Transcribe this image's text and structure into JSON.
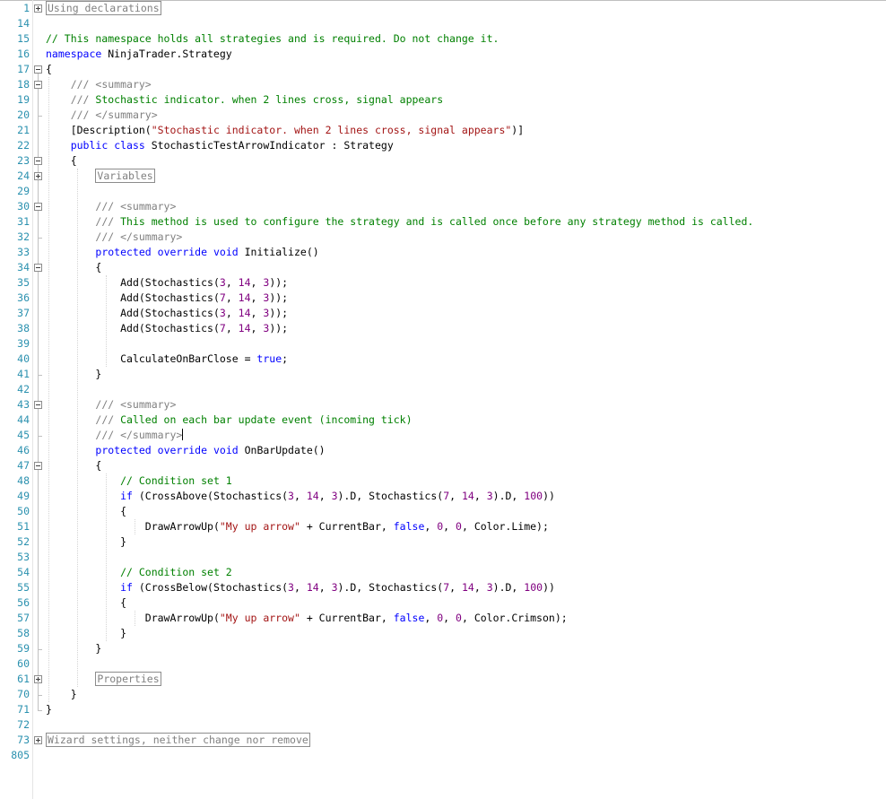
{
  "editor": {
    "lines": [
      {
        "n": "1",
        "indent": "",
        "seg": [
          {
            "t": "Using declarations",
            "c": "collapsed"
          }
        ],
        "fold": "plus"
      },
      {
        "n": "14",
        "indent": "",
        "seg": []
      },
      {
        "n": "15",
        "indent": "",
        "seg": [
          {
            "t": "// This namespace holds all strategies and is required. Do not change it.",
            "c": "cm"
          }
        ]
      },
      {
        "n": "16",
        "indent": "",
        "seg": [
          {
            "t": "namespace",
            "c": "kw"
          },
          {
            "t": " NinjaTrader.Strategy"
          }
        ]
      },
      {
        "n": "17",
        "indent": "",
        "seg": [
          {
            "t": "{"
          }
        ],
        "fold": "minus"
      },
      {
        "n": "18",
        "indent": "    ",
        "seg": [
          {
            "t": "/// <summary>",
            "c": "xd"
          }
        ],
        "fold": "minus"
      },
      {
        "n": "19",
        "indent": "    ",
        "seg": [
          {
            "t": "/// ",
            "c": "xd"
          },
          {
            "t": "Stochastic indicator. when 2 lines cross, signal appears",
            "c": "cm"
          }
        ]
      },
      {
        "n": "20",
        "indent": "    ",
        "seg": [
          {
            "t": "/// </summary>",
            "c": "xd"
          }
        ]
      },
      {
        "n": "21",
        "indent": "    ",
        "seg": [
          {
            "t": "[Description("
          },
          {
            "t": "\"Stochastic indicator. when 2 lines cross, signal appears\"",
            "c": "st"
          },
          {
            "t": ")]"
          }
        ]
      },
      {
        "n": "22",
        "indent": "    ",
        "seg": [
          {
            "t": "public",
            "c": "kw"
          },
          {
            "t": " "
          },
          {
            "t": "class",
            "c": "kw"
          },
          {
            "t": " StochasticTestArrowIndicator : Strategy"
          }
        ]
      },
      {
        "n": "23",
        "indent": "    ",
        "seg": [
          {
            "t": "{"
          }
        ],
        "fold": "minus"
      },
      {
        "n": "24",
        "indent": "        ",
        "seg": [
          {
            "t": "Variables",
            "c": "collapsed"
          }
        ],
        "fold": "plus"
      },
      {
        "n": "29",
        "indent": "",
        "seg": []
      },
      {
        "n": "30",
        "indent": "        ",
        "seg": [
          {
            "t": "/// <summary>",
            "c": "xd"
          }
        ],
        "fold": "minus"
      },
      {
        "n": "31",
        "indent": "        ",
        "seg": [
          {
            "t": "/// ",
            "c": "xd"
          },
          {
            "t": "This method is used to configure the strategy and is called once before any strategy method is called.",
            "c": "cm"
          }
        ]
      },
      {
        "n": "32",
        "indent": "        ",
        "seg": [
          {
            "t": "/// </summary>",
            "c": "xd"
          }
        ]
      },
      {
        "n": "33",
        "indent": "        ",
        "seg": [
          {
            "t": "protected",
            "c": "kw"
          },
          {
            "t": " "
          },
          {
            "t": "override",
            "c": "kw"
          },
          {
            "t": " "
          },
          {
            "t": "void",
            "c": "kw"
          },
          {
            "t": " Initialize()"
          }
        ]
      },
      {
        "n": "34",
        "indent": "        ",
        "seg": [
          {
            "t": "{"
          }
        ],
        "fold": "minus"
      },
      {
        "n": "35",
        "indent": "            ",
        "seg": [
          {
            "t": "Add(Stochastics("
          },
          {
            "t": "3",
            "c": "nm"
          },
          {
            "t": ", "
          },
          {
            "t": "14",
            "c": "nm"
          },
          {
            "t": ", "
          },
          {
            "t": "3",
            "c": "nm"
          },
          {
            "t": "));"
          }
        ]
      },
      {
        "n": "36",
        "indent": "            ",
        "seg": [
          {
            "t": "Add(Stochastics("
          },
          {
            "t": "7",
            "c": "nm"
          },
          {
            "t": ", "
          },
          {
            "t": "14",
            "c": "nm"
          },
          {
            "t": ", "
          },
          {
            "t": "3",
            "c": "nm"
          },
          {
            "t": "));"
          }
        ]
      },
      {
        "n": "37",
        "indent": "            ",
        "seg": [
          {
            "t": "Add(Stochastics("
          },
          {
            "t": "3",
            "c": "nm"
          },
          {
            "t": ", "
          },
          {
            "t": "14",
            "c": "nm"
          },
          {
            "t": ", "
          },
          {
            "t": "3",
            "c": "nm"
          },
          {
            "t": "));"
          }
        ]
      },
      {
        "n": "38",
        "indent": "            ",
        "seg": [
          {
            "t": "Add(Stochastics("
          },
          {
            "t": "7",
            "c": "nm"
          },
          {
            "t": ", "
          },
          {
            "t": "14",
            "c": "nm"
          },
          {
            "t": ", "
          },
          {
            "t": "3",
            "c": "nm"
          },
          {
            "t": "));"
          }
        ]
      },
      {
        "n": "39",
        "indent": "",
        "seg": []
      },
      {
        "n": "40",
        "indent": "            ",
        "seg": [
          {
            "t": "CalculateOnBarClose = "
          },
          {
            "t": "true",
            "c": "kw"
          },
          {
            "t": ";"
          }
        ]
      },
      {
        "n": "41",
        "indent": "        ",
        "seg": [
          {
            "t": "}"
          }
        ]
      },
      {
        "n": "42",
        "indent": "",
        "seg": []
      },
      {
        "n": "43",
        "indent": "        ",
        "seg": [
          {
            "t": "/// <summary>",
            "c": "xd"
          }
        ],
        "fold": "minus"
      },
      {
        "n": "44",
        "indent": "        ",
        "seg": [
          {
            "t": "/// ",
            "c": "xd"
          },
          {
            "t": "Called on each bar update event (incoming tick)",
            "c": "cm"
          }
        ]
      },
      {
        "n": "45",
        "indent": "        ",
        "seg": [
          {
            "t": "/// </summary>",
            "c": "xd"
          }
        ],
        "caret": true
      },
      {
        "n": "46",
        "indent": "        ",
        "seg": [
          {
            "t": "protected",
            "c": "kw"
          },
          {
            "t": " "
          },
          {
            "t": "override",
            "c": "kw"
          },
          {
            "t": " "
          },
          {
            "t": "void",
            "c": "kw"
          },
          {
            "t": " OnBarUpdate()"
          }
        ]
      },
      {
        "n": "47",
        "indent": "        ",
        "seg": [
          {
            "t": "{"
          }
        ],
        "fold": "minus"
      },
      {
        "n": "48",
        "indent": "            ",
        "seg": [
          {
            "t": "// Condition set 1",
            "c": "cm"
          }
        ]
      },
      {
        "n": "49",
        "indent": "            ",
        "seg": [
          {
            "t": "if",
            "c": "kw"
          },
          {
            "t": " (CrossAbove(Stochastics("
          },
          {
            "t": "3",
            "c": "nm"
          },
          {
            "t": ", "
          },
          {
            "t": "14",
            "c": "nm"
          },
          {
            "t": ", "
          },
          {
            "t": "3",
            "c": "nm"
          },
          {
            "t": ").D, Stochastics("
          },
          {
            "t": "7",
            "c": "nm"
          },
          {
            "t": ", "
          },
          {
            "t": "14",
            "c": "nm"
          },
          {
            "t": ", "
          },
          {
            "t": "3",
            "c": "nm"
          },
          {
            "t": ").D, "
          },
          {
            "t": "100",
            "c": "nm"
          },
          {
            "t": "))"
          }
        ]
      },
      {
        "n": "50",
        "indent": "            ",
        "seg": [
          {
            "t": "{"
          }
        ]
      },
      {
        "n": "51",
        "indent": "                ",
        "seg": [
          {
            "t": "DrawArrowUp("
          },
          {
            "t": "\"My up arrow\"",
            "c": "st"
          },
          {
            "t": " + CurrentBar, "
          },
          {
            "t": "false",
            "c": "kw"
          },
          {
            "t": ", "
          },
          {
            "t": "0",
            "c": "nm"
          },
          {
            "t": ", "
          },
          {
            "t": "0",
            "c": "nm"
          },
          {
            "t": ", Color.Lime);"
          }
        ]
      },
      {
        "n": "52",
        "indent": "            ",
        "seg": [
          {
            "t": "}"
          }
        ]
      },
      {
        "n": "53",
        "indent": "",
        "seg": []
      },
      {
        "n": "54",
        "indent": "            ",
        "seg": [
          {
            "t": "// Condition set 2",
            "c": "cm"
          }
        ]
      },
      {
        "n": "55",
        "indent": "            ",
        "seg": [
          {
            "t": "if",
            "c": "kw"
          },
          {
            "t": " (CrossBelow(Stochastics("
          },
          {
            "t": "3",
            "c": "nm"
          },
          {
            "t": ", "
          },
          {
            "t": "14",
            "c": "nm"
          },
          {
            "t": ", "
          },
          {
            "t": "3",
            "c": "nm"
          },
          {
            "t": ").D, Stochastics("
          },
          {
            "t": "7",
            "c": "nm"
          },
          {
            "t": ", "
          },
          {
            "t": "14",
            "c": "nm"
          },
          {
            "t": ", "
          },
          {
            "t": "3",
            "c": "nm"
          },
          {
            "t": ").D, "
          },
          {
            "t": "100",
            "c": "nm"
          },
          {
            "t": "))"
          }
        ]
      },
      {
        "n": "56",
        "indent": "            ",
        "seg": [
          {
            "t": "{"
          }
        ]
      },
      {
        "n": "57",
        "indent": "                ",
        "seg": [
          {
            "t": "DrawArrowUp("
          },
          {
            "t": "\"My up arrow\"",
            "c": "st"
          },
          {
            "t": " + CurrentBar, "
          },
          {
            "t": "false",
            "c": "kw"
          },
          {
            "t": ", "
          },
          {
            "t": "0",
            "c": "nm"
          },
          {
            "t": ", "
          },
          {
            "t": "0",
            "c": "nm"
          },
          {
            "t": ", Color.Crimson);"
          }
        ]
      },
      {
        "n": "58",
        "indent": "            ",
        "seg": [
          {
            "t": "}"
          }
        ]
      },
      {
        "n": "59",
        "indent": "        ",
        "seg": [
          {
            "t": "}"
          }
        ]
      },
      {
        "n": "60",
        "indent": "",
        "seg": []
      },
      {
        "n": "61",
        "indent": "        ",
        "seg": [
          {
            "t": "Properties",
            "c": "collapsed"
          }
        ],
        "fold": "plus"
      },
      {
        "n": "70",
        "indent": "    ",
        "seg": [
          {
            "t": "}"
          }
        ]
      },
      {
        "n": "71",
        "indent": "",
        "seg": [
          {
            "t": "}"
          }
        ]
      },
      {
        "n": "72",
        "indent": "",
        "seg": []
      },
      {
        "n": "73",
        "indent": "",
        "seg": [
          {
            "t": "Wizard settings, neither change nor remove",
            "c": "collapsed"
          }
        ],
        "fold": "plus"
      },
      {
        "n": "805",
        "indent": "",
        "seg": []
      }
    ]
  }
}
